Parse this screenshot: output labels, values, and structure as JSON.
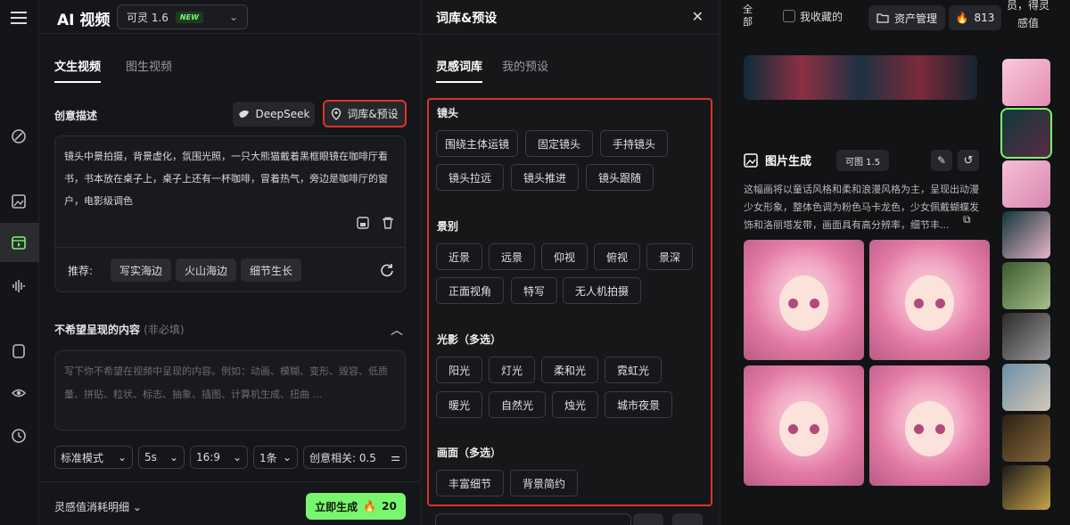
{
  "generator": {
    "brand": "AI 视频",
    "model_select": {
      "value": "可灵 1.6",
      "badge": "NEW"
    },
    "tabs": [
      {
        "label": "文生视频",
        "active": true
      },
      {
        "label": "图生视频",
        "active": false
      }
    ],
    "creative_label": "创意描述",
    "deepseek_label": "DeepSeek",
    "library_button_label": "词库&预设",
    "prompt_text": "镜头中景拍摄，背景虚化，氛围光照，一只大熊猫戴着黑框眼镜在咖啡厅看书，书本放在桌子上，桌子上还有一杯咖啡，冒着热气，旁边是咖啡厅的窗户，电影级调色",
    "recommend_label": "推荐:",
    "recommend_chips": [
      "写实海边",
      "火山海边",
      "细节生长"
    ],
    "negative_title": "不希望呈现的内容",
    "negative_optional": "(非必填)",
    "negative_placeholder": "写下你不希望在视频中呈现的内容。例如：动画、模糊、变形、毁容、低质量、拼贴、粒状、标志、抽象、插图、计算机生成、扭曲 ...",
    "options": {
      "mode": "标准模式",
      "duration": "5s",
      "ratio": "16:9",
      "count": "1条",
      "relevance": "创意相关: 0.5"
    },
    "cost_label": "灵感值消耗明细",
    "generate_label": "立即生成",
    "generate_cost": "20"
  },
  "library": {
    "title": "词库&预设",
    "tabs": [
      {
        "label": "灵感词库",
        "active": true
      },
      {
        "label": "我的预设",
        "active": false
      }
    ],
    "categories": [
      {
        "name": "镜头",
        "tags": [
          "围绕主体运镜",
          "固定镜头",
          "手持镜头",
          "镜头拉远",
          "镜头推进",
          "镜头跟随"
        ]
      },
      {
        "name": "景别",
        "tags": [
          "近景",
          "远景",
          "仰视",
          "俯视",
          "景深",
          "正面视角",
          "特写",
          "无人机拍摄"
        ]
      },
      {
        "name": "光影（多选）",
        "tags": [
          "阳光",
          "灯光",
          "柔和光",
          "霓虹光",
          "暖光",
          "自然光",
          "烛光",
          "城市夜景"
        ]
      },
      {
        "name": "画面（多选）",
        "tags": [
          "丰富细节",
          "背景简约"
        ]
      }
    ]
  },
  "gallery": {
    "filter_all": "全部",
    "my_favorites": "我收藏的",
    "assets_button": "资产管理",
    "credits": "813",
    "side_promo": "员，得灵感值",
    "image_gen_title": "图片生成",
    "image_model": "可图 1.5",
    "image_description": "这幅画将以童话风格和柔和浪漫风格为主，呈现出动漫少女形象，整体色调为粉色马卡龙色，少女佩戴蝴蝶发饰和洛丽塔发带，画面具有高分辨率，细节丰..."
  },
  "colors": {
    "accent_green": "#7af56e",
    "highlight_red": "#e0312a"
  }
}
